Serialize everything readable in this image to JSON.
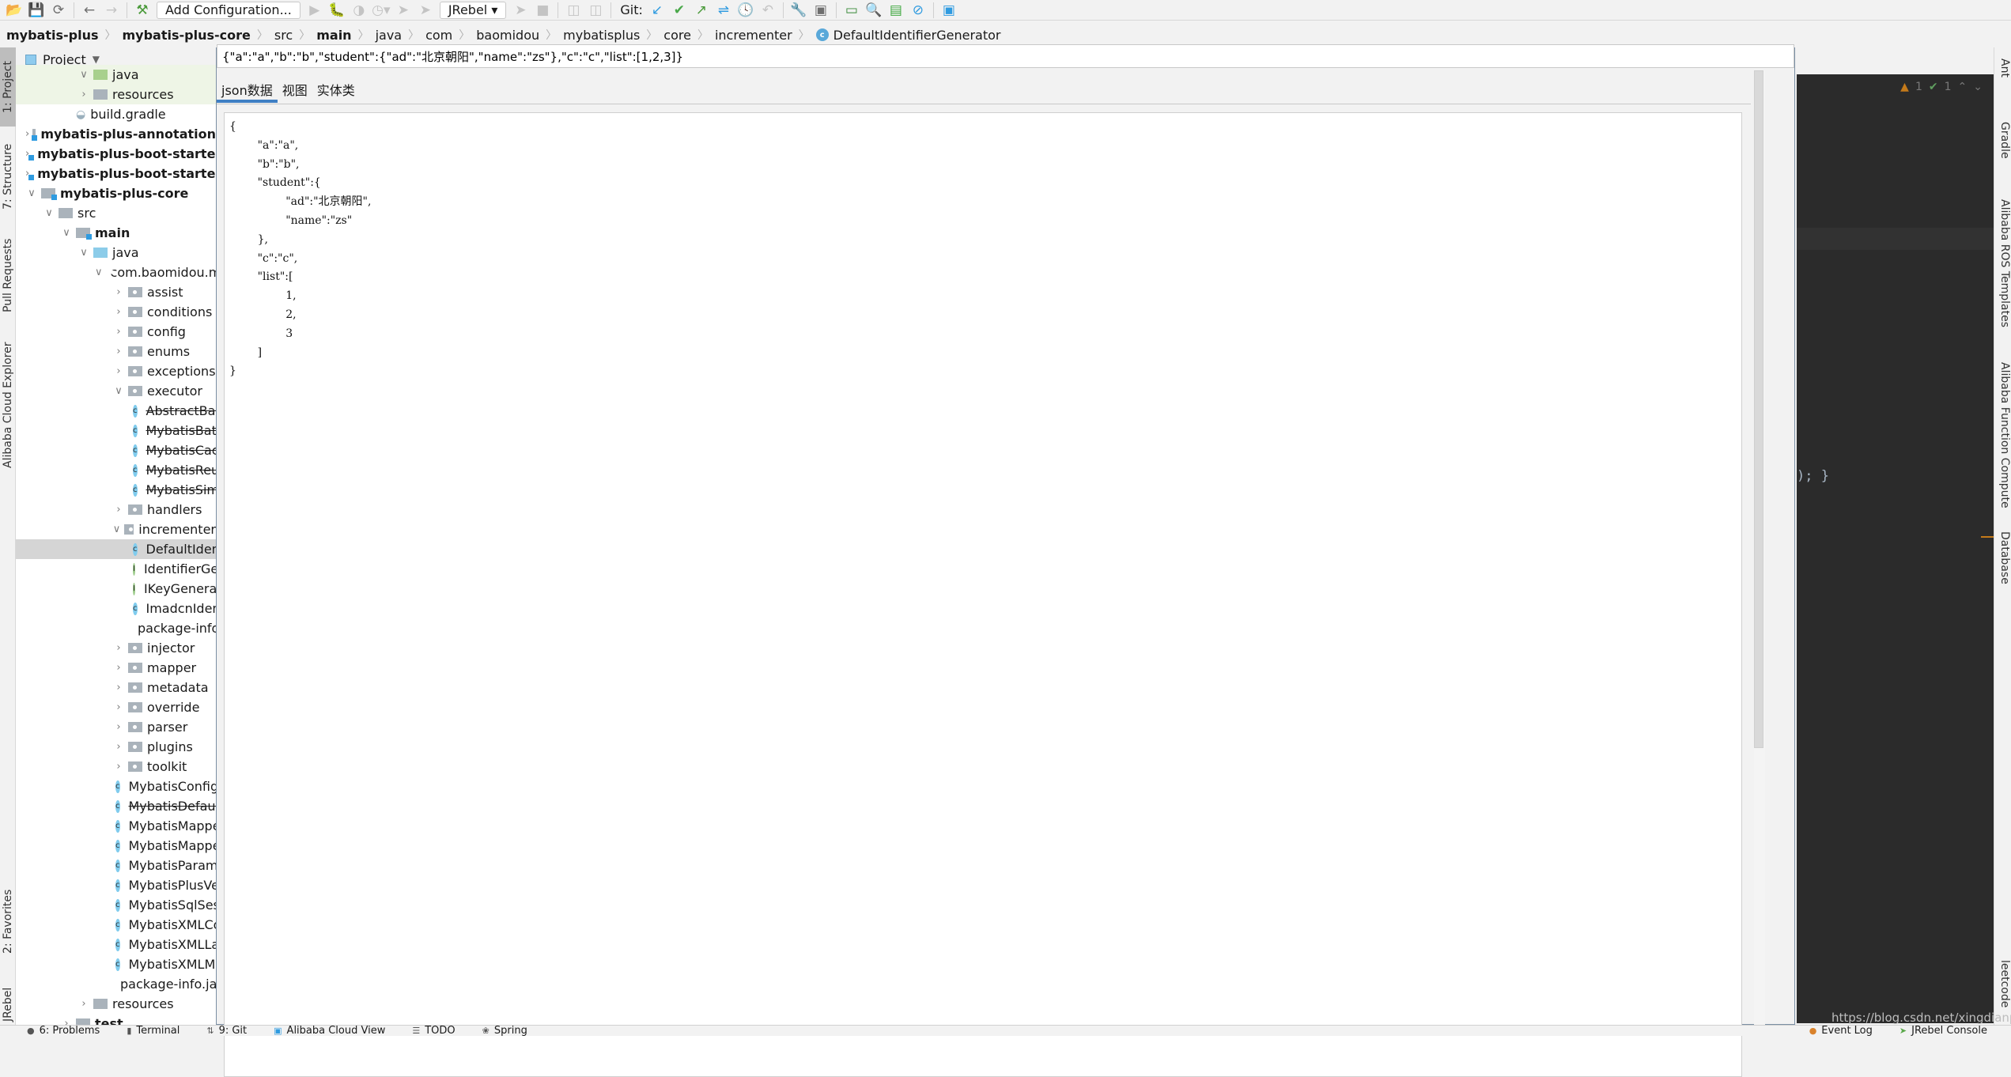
{
  "toolbar": {
    "add_configuration": "Add Configuration...",
    "run_config": "JRebel",
    "git_label": "Git:"
  },
  "breadcrumb": {
    "items": [
      "mybatis-plus",
      "mybatis-plus-core",
      "src",
      "main",
      "java",
      "com",
      "baomidou",
      "mybatisplus",
      "core",
      "incrementer",
      "DefaultIdentifierGenerator"
    ]
  },
  "left_strip": {
    "tabs": [
      "1: Project",
      "7: Structure",
      "Pull Requests",
      "Alibaba Cloud Explorer",
      "2: Favorites",
      "JRebel"
    ]
  },
  "right_strip": {
    "tabs": [
      "Ant",
      "Gradle",
      "Alibaba ROS Templates",
      "Alibaba Function Compute",
      "Database",
      "leetcode"
    ]
  },
  "project": {
    "title": "Project",
    "tree": [
      {
        "label": "java",
        "indent": 4,
        "kind": "folder-green",
        "chev": "expanded"
      },
      {
        "label": "resources",
        "indent": 4,
        "kind": "folder-res",
        "chev": "collapsed"
      },
      {
        "label": "build.gradle",
        "indent": 3,
        "kind": "gradle"
      },
      {
        "label": "mybatis-plus-annotation",
        "indent": 1,
        "kind": "module",
        "chev": "collapsed",
        "bold": true
      },
      {
        "label": "mybatis-plus-boot-starter",
        "indent": 1,
        "kind": "module",
        "chev": "collapsed",
        "bold": true
      },
      {
        "label": "mybatis-plus-boot-starter-test",
        "indent": 1,
        "kind": "module",
        "chev": "collapsed",
        "bold": true
      },
      {
        "label": "mybatis-plus-core",
        "indent": 1,
        "kind": "module",
        "chev": "expanded",
        "bold": true
      },
      {
        "label": "src",
        "indent": 2,
        "kind": "folder",
        "chev": "expanded"
      },
      {
        "label": "main",
        "indent": 3,
        "kind": "module",
        "chev": "expanded",
        "bold": true
      },
      {
        "label": "java",
        "indent": 4,
        "kind": "folder-blue",
        "chev": "expanded"
      },
      {
        "label": "com.baomidou.mybatisplus.core",
        "indent": 5,
        "kind": "package",
        "chev": "expanded"
      },
      {
        "label": "assist",
        "indent": 6,
        "kind": "package",
        "chev": "collapsed"
      },
      {
        "label": "conditions",
        "indent": 6,
        "kind": "package",
        "chev": "collapsed"
      },
      {
        "label": "config",
        "indent": 6,
        "kind": "package",
        "chev": "collapsed"
      },
      {
        "label": "enums",
        "indent": 6,
        "kind": "package",
        "chev": "collapsed"
      },
      {
        "label": "exceptions",
        "indent": 6,
        "kind": "package",
        "chev": "collapsed"
      },
      {
        "label": "executor",
        "indent": 6,
        "kind": "package",
        "chev": "expanded"
      },
      {
        "label": "AbstractBaseExecutor",
        "indent": 7,
        "kind": "class",
        "strike": true
      },
      {
        "label": "MybatisBatchExecutor",
        "indent": 7,
        "kind": "class",
        "strike": true
      },
      {
        "label": "MybatisCachingExecutor",
        "indent": 7,
        "kind": "class",
        "strike": true
      },
      {
        "label": "MybatisReuseExecutor",
        "indent": 7,
        "kind": "class",
        "strike": true
      },
      {
        "label": "MybatisSimpleExecutor",
        "indent": 7,
        "kind": "class",
        "strike": true
      },
      {
        "label": "handlers",
        "indent": 6,
        "kind": "package",
        "chev": "collapsed"
      },
      {
        "label": "incrementer",
        "indent": 6,
        "kind": "package",
        "chev": "expanded"
      },
      {
        "label": "DefaultIdentifierGenerator",
        "indent": 7,
        "kind": "class",
        "selected": true
      },
      {
        "label": "IdentifierGenerator",
        "indent": 7,
        "kind": "interface"
      },
      {
        "label": "IKeyGenerator",
        "indent": 7,
        "kind": "interface"
      },
      {
        "label": "ImadcnIdentifierGenerator",
        "indent": 7,
        "kind": "class"
      },
      {
        "label": "package-info.java",
        "indent": 7,
        "kind": "file"
      },
      {
        "label": "injector",
        "indent": 6,
        "kind": "package",
        "chev": "collapsed"
      },
      {
        "label": "mapper",
        "indent": 6,
        "kind": "package",
        "chev": "collapsed"
      },
      {
        "label": "metadata",
        "indent": 6,
        "kind": "package",
        "chev": "collapsed"
      },
      {
        "label": "override",
        "indent": 6,
        "kind": "package",
        "chev": "collapsed"
      },
      {
        "label": "parser",
        "indent": 6,
        "kind": "package",
        "chev": "collapsed"
      },
      {
        "label": "plugins",
        "indent": 6,
        "kind": "package",
        "chev": "collapsed"
      },
      {
        "label": "toolkit",
        "indent": 6,
        "kind": "package",
        "chev": "collapsed"
      },
      {
        "label": "MybatisConfiguration",
        "indent": 6,
        "kind": "class"
      },
      {
        "label": "MybatisDefaultParameterHandler",
        "indent": 6,
        "kind": "class",
        "strike": true
      },
      {
        "label": "MybatisMapperAnnotationBuilder",
        "indent": 6,
        "kind": "class"
      },
      {
        "label": "MybatisMapperRegistry",
        "indent": 6,
        "kind": "class"
      },
      {
        "label": "MybatisParameterHandler",
        "indent": 6,
        "kind": "class"
      },
      {
        "label": "MybatisPlusVersion",
        "indent": 6,
        "kind": "class"
      },
      {
        "label": "MybatisSqlSessionFactoryBuilder",
        "indent": 6,
        "kind": "class"
      },
      {
        "label": "MybatisXMLConfigBuilder",
        "indent": 6,
        "kind": "class"
      },
      {
        "label": "MybatisXMLLanguageDriver",
        "indent": 6,
        "kind": "class"
      },
      {
        "label": "MybatisXMLMapperBuilder",
        "indent": 6,
        "kind": "class"
      },
      {
        "label": "package-info.java",
        "indent": 6,
        "kind": "file"
      },
      {
        "label": "resources",
        "indent": 4,
        "kind": "folder-res",
        "chev": "collapsed"
      },
      {
        "label": "test",
        "indent": 3,
        "kind": "folder",
        "chev": "collapsed",
        "bold": true
      }
    ]
  },
  "dialog": {
    "json_input_value": "{\"a\":\"a\",\"b\":\"b\",\"student\":{\"ad\":\"北京朝阳\",\"name\":\"zs\"},\"c\":\"c\",\"list\":[1,2,3]}",
    "tabs": [
      "json数据",
      "视图",
      "实体类"
    ],
    "active_tab": 0,
    "formatted_json": "{\n\t\"a\":\"a\",\n\t\"b\":\"b\",\n\t\"student\":{\n\t\t\"ad\":\"北京朝阳\",\n\t\t\"name\":\"zs\"\n\t},\n\t\"c\":\"c\",\n\t\"list\":[\n\t\t1,\n\t\t2,\n\t\t3\n\t]\n}"
  },
  "editor": {
    "warnings": "1",
    "weak_warnings": "1",
    "code_tail": ");  }"
  },
  "watermark": "https://blog.csdn.net/xingdianp",
  "statusbar": {
    "left": [
      "6: Problems",
      "Terminal",
      "9: Git",
      "Alibaba Cloud View",
      "TODO",
      "Spring"
    ],
    "right": [
      "Event Log",
      "JRebel Console"
    ]
  }
}
